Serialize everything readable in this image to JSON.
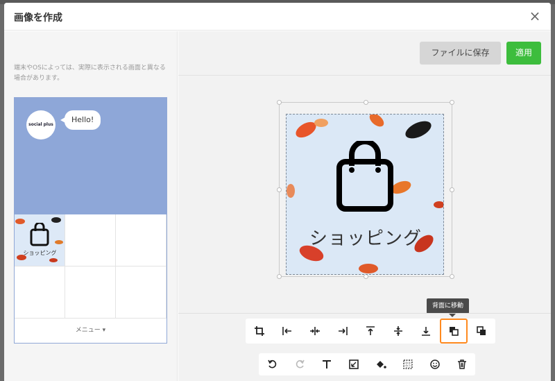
{
  "modal": {
    "title": "画像を作成",
    "close_glyph": "×"
  },
  "preview": {
    "notice": "端末やOSによっては、実際に表示される画面と異なる場合があります。",
    "avatar_text": "social plus",
    "bubble_text": "Hello!",
    "cell_label": "ショッピング",
    "menu_label": "メニュー ▾"
  },
  "editor": {
    "save_label": "ファイルに保存",
    "apply_label": "適用",
    "canvas_text": "ショッピング",
    "tooltip": "背面に移動"
  },
  "colors": {
    "accent_green": "#3dbd3d",
    "active_orange": "#ff8a1f",
    "chat_bg": "#8ea7d8",
    "canvas_bg": "#dbe8f6"
  },
  "toolbar": {
    "row1": [
      "crop-icon",
      "align-left-icon",
      "align-center-h-icon",
      "align-right-icon",
      "align-top-icon",
      "align-center-v-icon",
      "align-bottom-icon",
      "send-to-back-icon",
      "bring-to-front-icon"
    ],
    "row2": [
      "undo-icon",
      "redo-icon",
      "text-icon",
      "image-icon",
      "fill-icon",
      "grid-icon",
      "emoji-icon",
      "trash-icon"
    ]
  }
}
